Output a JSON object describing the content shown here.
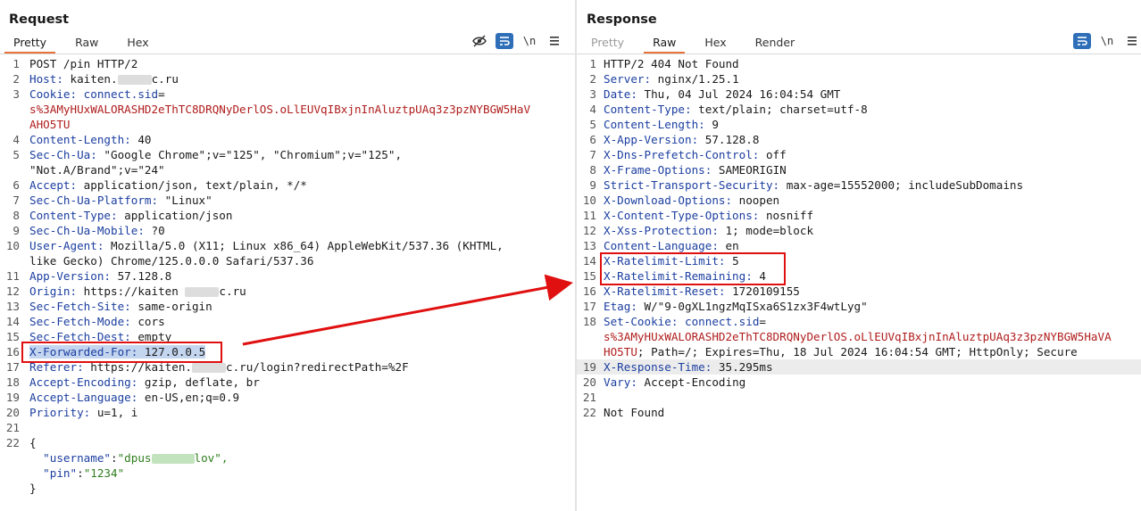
{
  "request": {
    "title": "Request",
    "tabs": [
      "Pretty",
      "Raw",
      "Hex"
    ],
    "active_tab": "Pretty",
    "toolbar": [
      "eye-off-icon",
      "wrap-icon",
      "\\n",
      "menu-icon"
    ],
    "lines": [
      {
        "n": "1",
        "h": "",
        "v": "POST /pin HTTP/2"
      },
      {
        "n": "2",
        "h": "Host:",
        "v": " kaiten.",
        "blur": "c.ru"
      },
      {
        "n": "3",
        "h": "Cookie:",
        "v": " ",
        "h2": "connect.sid",
        "v2": "="
      },
      {
        "n": "",
        "red": "s%3AMyHUxWALORASHD2eThTC8DRQNyDerlOS.oLlEUVqIBxjnInAluztpUAq3z3pzNYBGW5HaV"
      },
      {
        "n": "",
        "red": "AHO5TU"
      },
      {
        "n": "4",
        "h": "Content-Length:",
        "v": " 40"
      },
      {
        "n": "5",
        "h": "Sec-Ch-Ua:",
        "v": " \"Google Chrome\";v=\"125\", \"Chromium\";v=\"125\","
      },
      {
        "n": "",
        "h": "",
        "v": "\"Not.A/Brand\";v=\"24\""
      },
      {
        "n": "6",
        "h": "Accept:",
        "v": " application/json, text/plain, */*"
      },
      {
        "n": "7",
        "h": "Sec-Ch-Ua-Platform:",
        "v": " \"Linux\""
      },
      {
        "n": "8",
        "h": "Content-Type:",
        "v": " application/json"
      },
      {
        "n": "9",
        "h": "Sec-Ch-Ua-Mobile:",
        "v": " ?0"
      },
      {
        "n": "10",
        "h": "User-Agent:",
        "v": " Mozilla/5.0 (X11; Linux x86_64) AppleWebKit/537.36 (KHTML,"
      },
      {
        "n": "",
        "h": "",
        "v": "like Gecko) Chrome/125.0.0.0 Safari/537.36"
      },
      {
        "n": "11",
        "h": "App-Version:",
        "v": " 57.128.8"
      },
      {
        "n": "12",
        "h": "Origin:",
        "v": " https://kaiten ",
        "blur": "c.ru"
      },
      {
        "n": "13",
        "h": "Sec-Fetch-Site:",
        "v": " same-origin"
      },
      {
        "n": "14",
        "h": "Sec-Fetch-Mode:",
        "v": " cors"
      },
      {
        "n": "15",
        "h": "Sec-Fetch-Dest:",
        "v": " empty"
      },
      {
        "n": "16",
        "h": "X-Forwarded-For:",
        "v": " 127.0.0.5",
        "selected": true
      },
      {
        "n": "17",
        "h": "Referer:",
        "v": " https://kaiten.",
        "blur": "c.ru/login?redirectPath=%2F"
      },
      {
        "n": "18",
        "h": "Accept-Encoding:",
        "v": " gzip, deflate, br"
      },
      {
        "n": "19",
        "h": "Accept-Language:",
        "v": " en-US,en;q=0.9"
      },
      {
        "n": "20",
        "h": "Priority:",
        "v": " u=1, i"
      },
      {
        "n": "21",
        "h": "",
        "v": ""
      },
      {
        "n": "22",
        "h": "",
        "v": "{"
      },
      {
        "n": "",
        "json": true,
        "k": "\"username\"",
        "s": ":",
        "g": "\"dpus",
        "gblur": "lov\","
      },
      {
        "n": "",
        "json": true,
        "k": "\"pin\"",
        "s": ":",
        "g": "\"1234\""
      },
      {
        "n": "",
        "h": "",
        "v": "}"
      }
    ]
  },
  "response": {
    "title": "Response",
    "tabs": [
      "Pretty",
      "Raw",
      "Hex",
      "Render"
    ],
    "active_tab": "Raw",
    "toolbar": [
      "wrap-icon",
      "\\n",
      "menu-icon"
    ],
    "lines": [
      {
        "n": "1",
        "h": "",
        "v": "HTTP/2 404 Not Found"
      },
      {
        "n": "2",
        "h": "Server:",
        "v": " nginx/1.25.1"
      },
      {
        "n": "3",
        "h": "Date:",
        "v": " Thu, 04 Jul 2024 16:04:54 GMT"
      },
      {
        "n": "4",
        "h": "Content-Type:",
        "v": " text/plain; charset=utf-8"
      },
      {
        "n": "5",
        "h": "Content-Length:",
        "v": " 9"
      },
      {
        "n": "6",
        "h": "X-App-Version:",
        "v": " 57.128.8"
      },
      {
        "n": "7",
        "h": "X-Dns-Prefetch-Control:",
        "v": " off"
      },
      {
        "n": "8",
        "h": "X-Frame-Options:",
        "v": " SAMEORIGIN"
      },
      {
        "n": "9",
        "h": "Strict-Transport-Security:",
        "v": " max-age=15552000; includeSubDomains"
      },
      {
        "n": "10",
        "h": "X-Download-Options:",
        "v": " noopen"
      },
      {
        "n": "11",
        "h": "X-Content-Type-Options:",
        "v": " nosniff"
      },
      {
        "n": "12",
        "h": "X-Xss-Protection:",
        "v": " 1; mode=block"
      },
      {
        "n": "13",
        "h": "Content-Language:",
        "v": " en"
      },
      {
        "n": "14",
        "h": "X-Ratelimit-Limit:",
        "v": " 5"
      },
      {
        "n": "15",
        "h": "X-Ratelimit-Remaining:",
        "v": " 4"
      },
      {
        "n": "16",
        "h": "X-Ratelimit-Reset:",
        "v": " 1720109155"
      },
      {
        "n": "17",
        "h": "Etag:",
        "v": " W/\"9-0gXL1ngzMqISxa6S1zx3F4wtLyg\""
      },
      {
        "n": "18",
        "h": "Set-Cookie:",
        "v": " ",
        "h2": "connect.sid",
        "v2": "="
      },
      {
        "n": "",
        "red": "s%3AMyHUxWALORASHD2eThTC8DRQNyDerlOS.oLlEUVqIBxjnInAluztpUAq3z3pzNYBGW5HaVA"
      },
      {
        "n": "",
        "red": "HO5TU",
        "v": "; Path=/; Expires=Thu, 18 Jul 2024 16:04:54 GMT; HttpOnly; Secure"
      },
      {
        "n": "19",
        "h": "X-Response-Time:",
        "v": " 35.295ms",
        "hl": true
      },
      {
        "n": "20",
        "h": "Vary:",
        "v": " Accept-Encoding"
      },
      {
        "n": "21",
        "h": "",
        "v": ""
      },
      {
        "n": "22",
        "h": "",
        "v": "Not Found"
      }
    ]
  },
  "colors": {
    "accent": "#e8723a",
    "header_name": "#1b3ea0",
    "cookie_value": "#b01d1d",
    "json_string": "#2f7d1e",
    "annotation": "#e01010",
    "toolbar_blue": "#2e6fb8"
  }
}
